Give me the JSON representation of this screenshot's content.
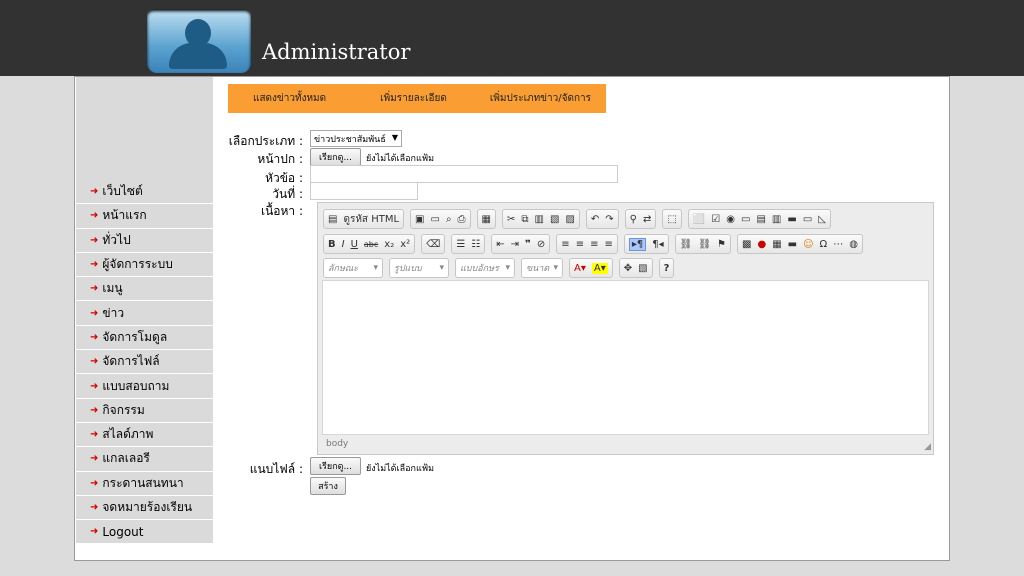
{
  "header": {
    "title": "Administrator",
    "avatar_icon": "user-avatar-icon"
  },
  "sidebar": {
    "items": [
      {
        "label": "เว็บไซต์"
      },
      {
        "label": "หน้าแรก"
      },
      {
        "label": "ทั่วไป"
      },
      {
        "label": "ผู้จัดการระบบ"
      },
      {
        "label": "เมนู"
      },
      {
        "label": "ข่าว"
      },
      {
        "label": "จัดการโมดูล"
      },
      {
        "label": "จัดการไฟล์"
      },
      {
        "label": "แบบสอบถาม"
      },
      {
        "label": "กิจกรรม"
      },
      {
        "label": "สไลด์ภาพ"
      },
      {
        "label": "แกลเลอรี"
      },
      {
        "label": "กระดานสนทนา"
      },
      {
        "label": "จดหมายร้องเรียน"
      },
      {
        "label": "Logout"
      }
    ]
  },
  "tabs": {
    "show_all": "แสดงข่าวทั้งหมด",
    "add_detail": "เพิ่มรายละเอียด",
    "add_category": "เพิ่มประเภทข่าว/จัดการ"
  },
  "form": {
    "category_label": "เลือกประเภท :",
    "category_value": "ข่าวประชาสัมพันธ์",
    "cover_label": "หน้าปก :",
    "browse_label": "เรียกดู...",
    "no_file_text": "ยังไม่ได้เลือกแฟ้ม",
    "title_label": "หัวข้อ :",
    "date_label": "วันที่ :",
    "content_label": "เนื้อหา :",
    "attach_label": "แนบไฟล์ :",
    "attach_browse_label": "เรียกดู...",
    "attach_no_file_text": "ยังไม่ได้เลือกแฟ้ม",
    "create_label": "สร้าง"
  },
  "editor": {
    "source_label": "ดูรหัส HTML",
    "combo_style": "ลักษณะ",
    "combo_format": "รูปแบบ",
    "combo_font": "แบบอักษร",
    "combo_size": "ขนาด",
    "path": "body"
  }
}
